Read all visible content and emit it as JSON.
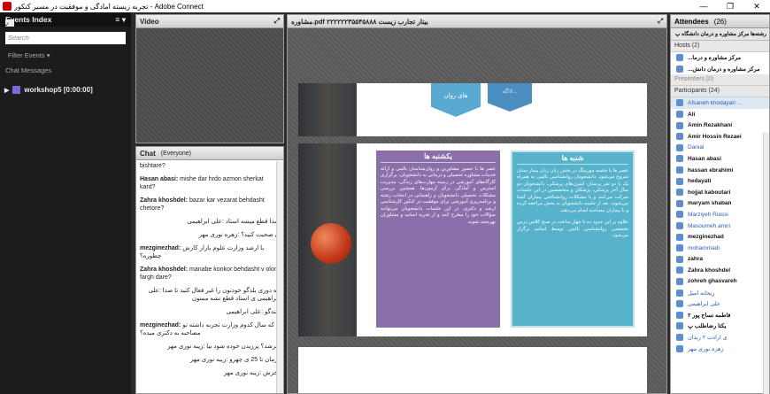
{
  "window": {
    "title": "تجربه زیسته آمادگی و موفقیت در مسیر کنکور - Adobe Connect",
    "minimize": "—",
    "maximize": "❐",
    "close": "✕"
  },
  "events": {
    "title": "Events Index",
    "menu": "≡ ▾",
    "search_placeholder": "Search",
    "filter": "Filter Events ▾",
    "chat_messages": "Chat Messages",
    "item": "workshop5 [0:00:00]"
  },
  "video": {
    "title": "Video",
    "fullscreen": "⤢"
  },
  "chat": {
    "title": "Chat",
    "scope": "(Everyone)",
    "messages": [
      {
        "sender": "",
        "text": "bishtare?"
      },
      {
        "sender": "Hasan abasi:",
        "text": " mishe dar hrdo azmon sherkat kard?"
      },
      {
        "sender": "Zahra khoshdel:",
        "text": " bazar kar  vezarat behdasht chetore?"
      },
      {
        "sender": "",
        "text": "صدا قطع میشه استاد :علی ابراهیمی",
        "rtl": true
      },
      {
        "sender": "",
        "text": "ی صحبت کنید؟ :زهره نوری مهر",
        "rtl": true
      },
      {
        "sender": "mezginezhad:",
        "text": " با ارشد وزارت علوم بازار کارش چطوره؟",
        "rtl": false
      },
      {
        "sender": "Zahra khoshdel:",
        "text": " manabe konkor behdasht v olom  fargh dare?"
      },
      {
        "sender": "",
        "text": "زه دوری بلدگو خودتون را غیر فعال کنید تا صدا :علی ابراهیمی ی استاد قطع نشه ممنون",
        "rtl": true
      },
      {
        "sender": "",
        "text": "بلندگو :علی ابراهیمی",
        "rtl": true
      },
      {
        "sender": "mezginezhad:",
        "text": " که سال کدوم وزارت تجربه داشته تو مصاحبه به دکتری میده؟"
      },
      {
        "sender": "",
        "text": "خرشد؟ پرزیدن خوده شود بیا :زیبه نوری مهر",
        "rtl": true
      },
      {
        "sender": "",
        "text": "ترمان تا 25 ی چهرو :زیبه نوری مهر",
        "rtl": true
      },
      {
        "sender": "",
        "text": "بخرش :زیبه نوری مهر",
        "rtl": true
      }
    ]
  },
  "share": {
    "title": "مشاوره.pdf ۲۲۲۲۲۲۳۵۵۴۵۸۸۸ بیتار تجارب زیست",
    "fullscreen": "⤢",
    "hex_main": "های روان",
    "hex_small": "لااگه...",
    "box_left_title": "یکشنبه ها",
    "box_left_text": "عصر ها با حضور مشاورین و روان‌شناسان بالینی و ارائه خدمات مشاوره تحصیلی و درمانی به دانشجویان، برگزاری کارگاه‌های آموزشی در زمینه مهارت‌های زندگی، مدیریت استرس و آمادگی برای آزمون‌ها. همچنین بررسی مشکلات تحصیلی دانشجویان و راهنمایی در انتخاب رشته و برنامه‌ریزی آموزشی برای موفقیت در کنکور کارشناسی ارشد و دکتری. در این جلسات دانشجویان می‌توانند سؤالات خود را مطرح کنند و از تجربه اساتید و مشاوران بهره‌مند شوند.",
    "box_right_title": "شنبه ها",
    "box_right_text": "عصر ها با جلسه مورنینگ در بخش زنان زنان بیمار ستان شروع می‌شود. دانشجویان روانشناسی بالینی به همراه یک یا دو نفر پرستار، اینترن‌های پزشکی، دانشجویان دو سال آخر پزشکی، پزشکان و متخصصین در این جلسات شرکت می‌کنند و با مشکلات روانشناختی بیماران آشنا می‌شوند. بعد از جلسه دانشجویان به بخش مراجعه کرده و با بیماران مصاحبه انجام می‌دهند.",
    "box_right_text2": "علاوه بر این حدود ده تا چهار ساعت در صبح کلاس درس تخصصی روانشناسی بالینی توسط اساتید برگزار می‌شود."
  },
  "attendees": {
    "title": "Attendees",
    "count": "(26)",
    "me": "رشته‌ها مرکز مشاوره و درمان دانشگاه پ",
    "hosts_label": "Hosts (2)",
    "hosts": [
      "...مرکز مشاوره و درما",
      "...مرکز مشاوره و درمان دانش"
    ],
    "presenters_label": "Presenters (0)",
    "participants_label": "Participants (24)",
    "participants": [
      {
        "name": "Afsaneh khodayari ...",
        "link": true,
        "sel": true
      },
      {
        "name": "Ali"
      },
      {
        "name": "Amin Rezakhani"
      },
      {
        "name": "Amir Hossin Rezaei"
      },
      {
        "name": "Danial",
        "link": true
      },
      {
        "name": "Hasan abasi"
      },
      {
        "name": "hassan ebrahimi"
      },
      {
        "name": "hedayati"
      },
      {
        "name": "hojjat kaboutari"
      },
      {
        "name": "maryam shaban"
      },
      {
        "name": "Marziyeh Riassi",
        "link": true
      },
      {
        "name": "Masoumeh amiri",
        "link": true
      },
      {
        "name": "mezginezhad"
      },
      {
        "name": "mohammadi",
        "link": true
      },
      {
        "name": "zahra"
      },
      {
        "name": "Zahra khoshdel"
      },
      {
        "name": "zohreh ghasvareh"
      },
      {
        "name": "ریحانه امیل",
        "link": true
      },
      {
        "name": "علی ابراهیمی",
        "link": true
      },
      {
        "name": "فاطمه نساج پور ۲"
      },
      {
        "name": "یکتا رضاطلب پ"
      },
      {
        "name": "ی ارادت ۲ زندان",
        "link": true
      },
      {
        "name": "زهره نوری مهر",
        "link": true
      }
    ]
  }
}
